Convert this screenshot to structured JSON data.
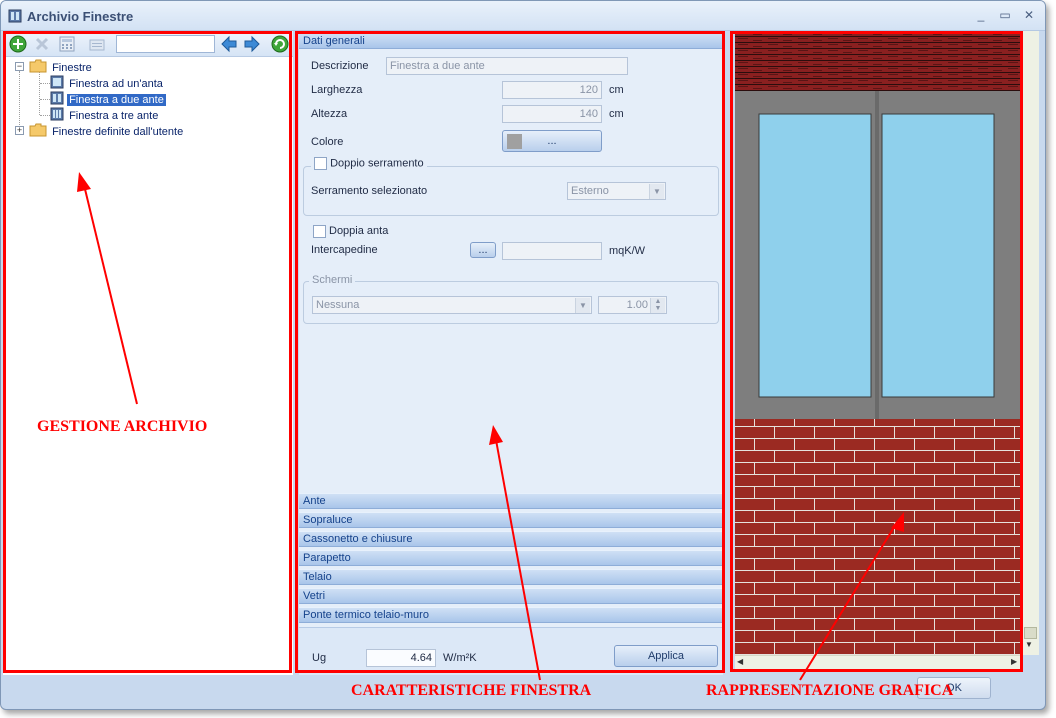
{
  "window": {
    "title": "Archivio Finestre",
    "minimize_glyph": "_",
    "maximize_glyph": "▭",
    "close_glyph": "✕"
  },
  "toolbar": {
    "icons": [
      "add-icon",
      "delete-icon",
      "calculator-icon",
      "report-icon",
      "search-field",
      "back-arrow-icon",
      "forward-arrow-icon",
      "refresh-icon"
    ],
    "search_value": ""
  },
  "tree": {
    "root": {
      "label": "Finestre",
      "expanded": true
    },
    "children": [
      {
        "label": "Finestra ad un'anta",
        "selected": false
      },
      {
        "label": "Finestra a due ante",
        "selected": true
      },
      {
        "label": "Finestra a tre ante",
        "selected": false
      }
    ],
    "user_root": {
      "label": "Finestre definite dall'utente",
      "expanded": false
    }
  },
  "general": {
    "header": "Dati generali",
    "descrizione_label": "Descrizione",
    "descrizione_value": "Finestra a due ante",
    "larghezza_label": "Larghezza",
    "larghezza_value": "120",
    "larghezza_unit": "cm",
    "altezza_label": "Altezza",
    "altezza_value": "140",
    "altezza_unit": "cm",
    "colore_label": "Colore",
    "colore_button": "...",
    "colore_swatch": "#a0a0a0",
    "doppio_serramento_label": "Doppio serramento",
    "doppio_serramento_checked": false,
    "serramento_label": "Serramento selezionato",
    "serramento_value": "Esterno",
    "doppia_anta_label": "Doppia anta",
    "doppia_anta_checked": false,
    "intercapedine_label": "Intercapedine",
    "intercapedine_button": "...",
    "intercapedine_value": "",
    "intercapedine_unit": "mqK/W",
    "schermi_title": "Schermi",
    "schermi_value": "Nessuna",
    "schermi_factor": "1.00"
  },
  "sections": [
    "Ante",
    "Sopraluce",
    "Cassonetto e chiusure",
    "Parapetto",
    "Telaio",
    "Vetri",
    "Ponte termico telaio-muro"
  ],
  "footer": {
    "ug_label": "Ug",
    "ug_value": "4.64",
    "ug_unit": "W/m²K",
    "apply_label": "Applica",
    "ok_label": "OK"
  },
  "drawing": {
    "brick_color": "#9b2a22",
    "mortar_color": "#e6e2dc",
    "frame_color": "#7e7e7e",
    "glass_color": "#8fd0ec",
    "wood_color": "#8a2020"
  },
  "annotations": {
    "left": "GESTIONE ARCHIVIO",
    "middle": "CARATTERISTICHE FINESTRA",
    "right": "RAPPRESENTAZIONE GRAFICA",
    "color": "#ff0000"
  }
}
